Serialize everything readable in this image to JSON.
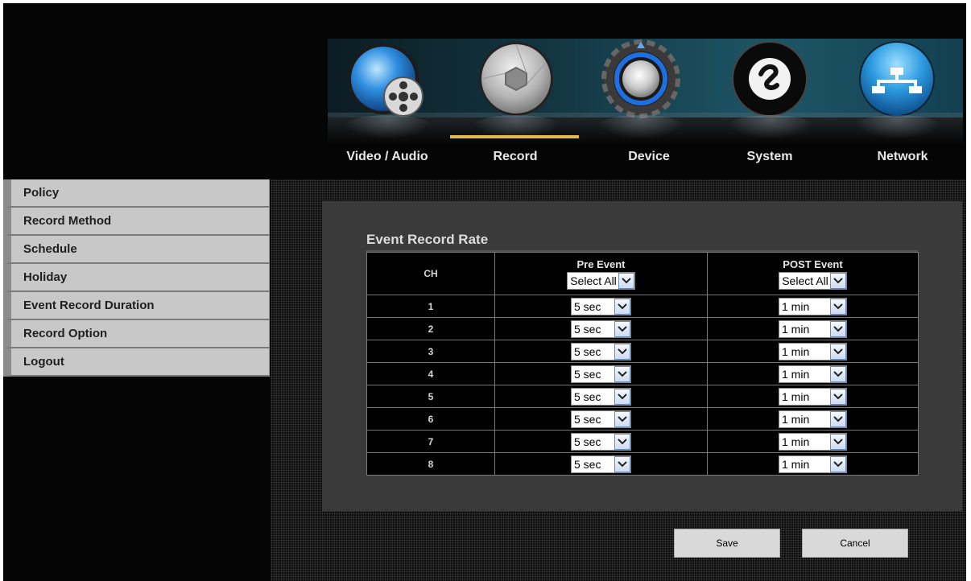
{
  "nav": {
    "tabs": [
      {
        "label": "Video / Audio",
        "icon": "film-reel-icon"
      },
      {
        "label": "Record",
        "icon": "camera-shutter-icon",
        "active": true
      },
      {
        "label": "Device",
        "icon": "knob-gear-icon"
      },
      {
        "label": "System",
        "icon": "swirl-icon"
      },
      {
        "label": "Network",
        "icon": "network-tree-icon"
      }
    ],
    "accent": "#e6b84a"
  },
  "sidebar": {
    "items": [
      {
        "label": "Policy"
      },
      {
        "label": "Record Method"
      },
      {
        "label": "Schedule"
      },
      {
        "label": "Holiday"
      },
      {
        "label": "Event Record Duration"
      },
      {
        "label": "Record Option"
      },
      {
        "label": "Logout"
      }
    ]
  },
  "main": {
    "title": "Event Record Rate",
    "table": {
      "headers": {
        "ch": "CH",
        "pre": "Pre Event",
        "post": "POST Event"
      },
      "select_all": {
        "pre": "Select All",
        "post": "Select All"
      },
      "rows": [
        {
          "ch": "1",
          "pre": "5 sec",
          "post": "1 min"
        },
        {
          "ch": "2",
          "pre": "5 sec",
          "post": "1 min"
        },
        {
          "ch": "3",
          "pre": "5 sec",
          "post": "1 min"
        },
        {
          "ch": "4",
          "pre": "5 sec",
          "post": "1 min"
        },
        {
          "ch": "5",
          "pre": "5 sec",
          "post": "1 min"
        },
        {
          "ch": "6",
          "pre": "5 sec",
          "post": "1 min"
        },
        {
          "ch": "7",
          "pre": "5 sec",
          "post": "1 min"
        },
        {
          "ch": "8",
          "pre": "5 sec",
          "post": "1 min"
        }
      ]
    },
    "buttons": {
      "save": "Save",
      "cancel": "Cancel"
    }
  }
}
